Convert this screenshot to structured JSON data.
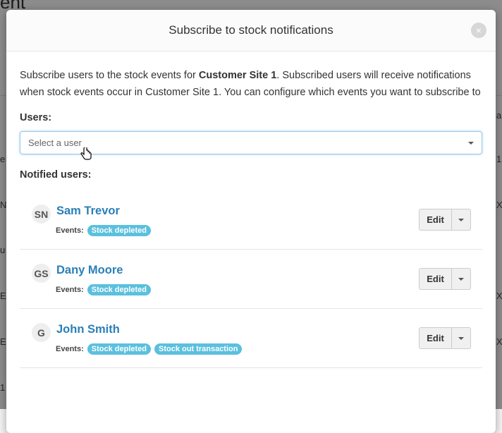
{
  "background": {
    "title_fragment": "ent",
    "left_fragments": [
      "e",
      "N",
      "u",
      "E",
      "E",
      "1"
    ],
    "right_fragments": [
      "a",
      "1",
      "X",
      "X",
      "X"
    ]
  },
  "modal": {
    "title": "Subscribe to stock notifications",
    "close_label": "×",
    "intro_prefix": "Subscribe users to the stock events for ",
    "intro_site": "Customer Site 1",
    "intro_suffix": ". Subscribed users will receive notifications when stock events occur in Customer Site 1. You can configure which events you want to subscribe to",
    "users_label": "Users:",
    "user_select": {
      "placeholder": "Select a user"
    },
    "notified_label": "Notified users:",
    "events_label": "Events:",
    "edit_label": "Edit",
    "notified_users": [
      {
        "initials": "SN",
        "name": "Sam Trevor",
        "events": [
          "Stock depleted"
        ]
      },
      {
        "initials": "GS",
        "name": "Dany Moore",
        "events": [
          "Stock depleted"
        ]
      },
      {
        "initials": "G",
        "name": "John Smith",
        "events": [
          "Stock depleted",
          "Stock out transaction"
        ]
      }
    ]
  },
  "colors": {
    "link": "#2a7fb8",
    "badge": "#5bc0de",
    "focus_border": "#9ec9e4"
  }
}
